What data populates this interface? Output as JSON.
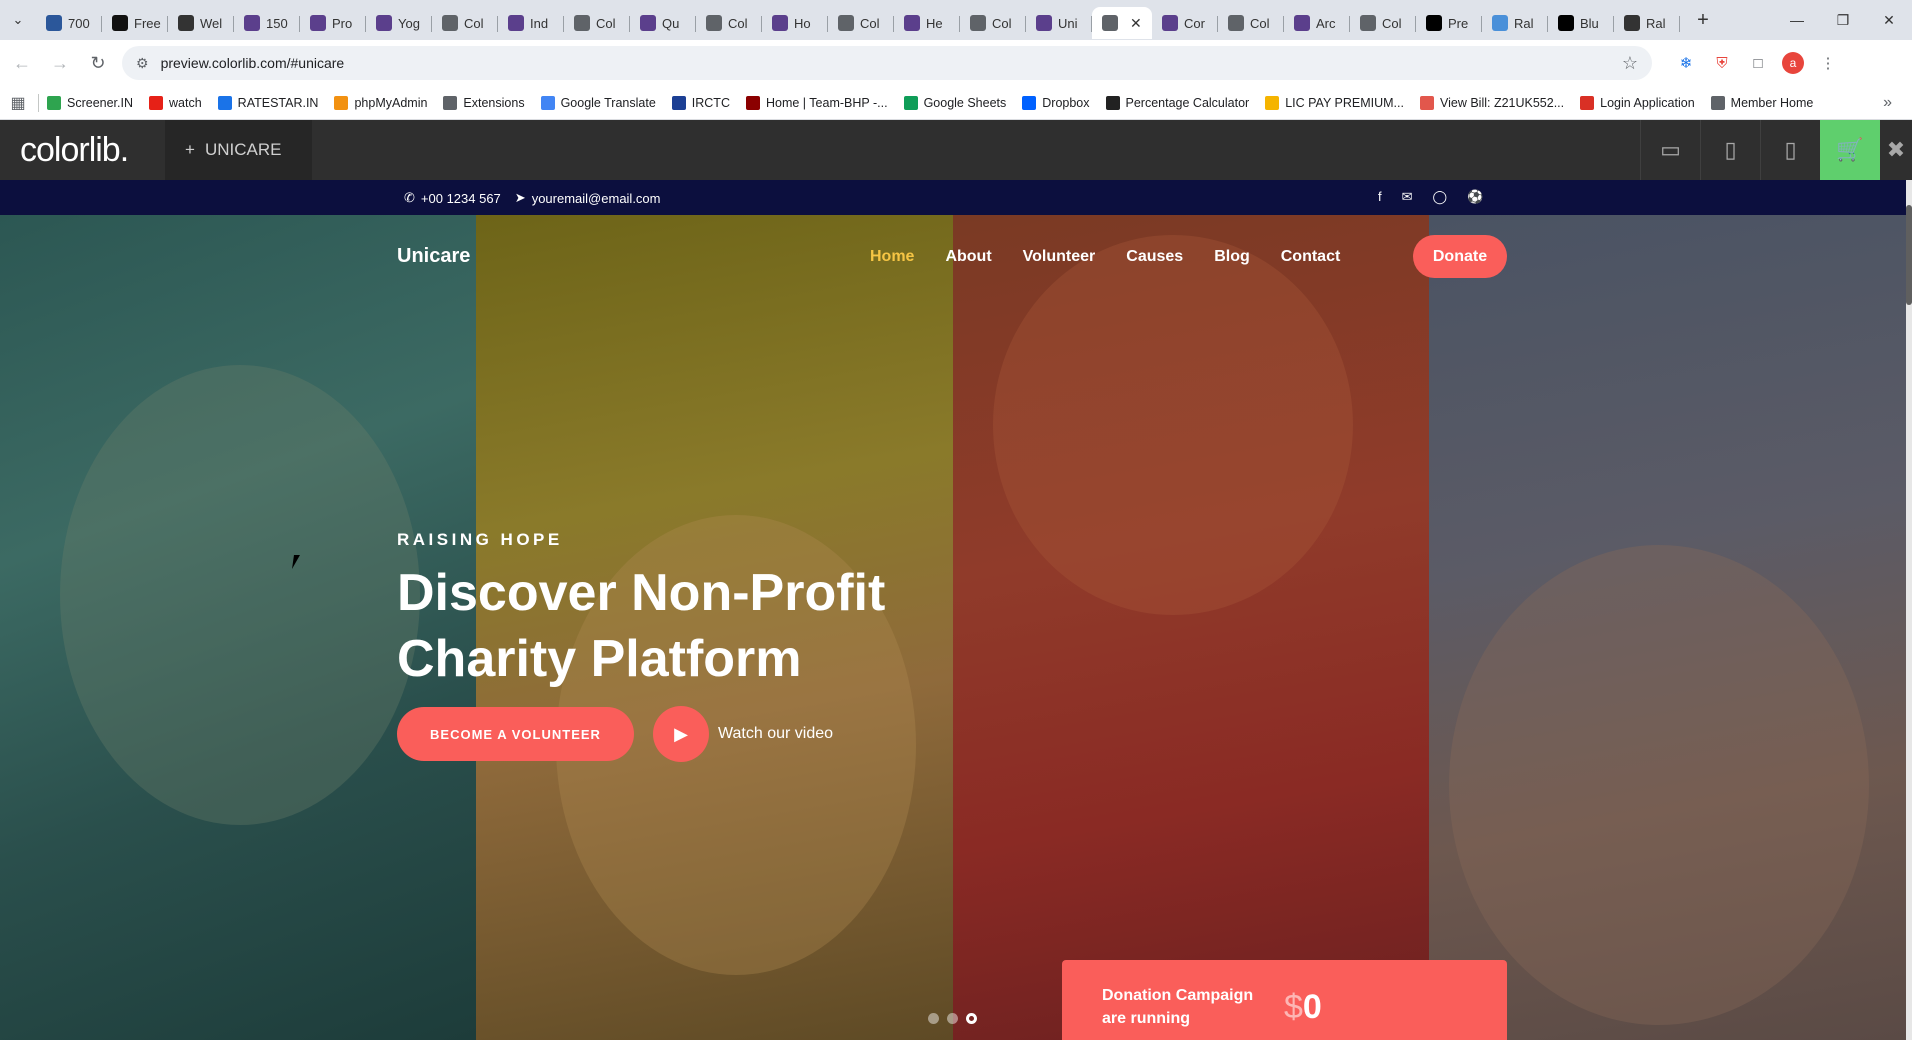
{
  "browser": {
    "tabs": [
      {
        "title": "700",
        "favicon": "word-icon",
        "color": "#2b579a"
      },
      {
        "title": "Free",
        "favicon": "framer-icon",
        "color": "#111111"
      },
      {
        "title": "Wel",
        "favicon": "wix-icon",
        "color": "#333333"
      },
      {
        "title": "150",
        "favicon": "colorlib-icon",
        "color": "#5b3f8c"
      },
      {
        "title": "Pro",
        "favicon": "colorlib-icon",
        "color": "#5b3f8c"
      },
      {
        "title": "Yog",
        "favicon": "colorlib-icon",
        "color": "#5b3f8c"
      },
      {
        "title": "Col",
        "favicon": "globe-icon",
        "color": "#5f6368"
      },
      {
        "title": "Ind",
        "favicon": "colorlib-icon",
        "color": "#5b3f8c"
      },
      {
        "title": "Col",
        "favicon": "globe-icon",
        "color": "#5f6368"
      },
      {
        "title": "Qu",
        "favicon": "colorlib-icon",
        "color": "#5b3f8c"
      },
      {
        "title": "Col",
        "favicon": "globe-icon",
        "color": "#5f6368"
      },
      {
        "title": "Ho",
        "favicon": "colorlib-icon",
        "color": "#5b3f8c"
      },
      {
        "title": "Col",
        "favicon": "globe-icon",
        "color": "#5f6368"
      },
      {
        "title": "He",
        "favicon": "colorlib-icon",
        "color": "#5b3f8c"
      },
      {
        "title": "Col",
        "favicon": "globe-icon",
        "color": "#5f6368"
      },
      {
        "title": "Uni",
        "favicon": "colorlib-icon",
        "color": "#5b3f8c"
      },
      {
        "title": "",
        "favicon": "globe-icon",
        "color": "#5f6368",
        "active": true
      },
      {
        "title": "Cor",
        "favicon": "colorlib-icon",
        "color": "#5b3f8c"
      },
      {
        "title": "Col",
        "favicon": "globe-icon",
        "color": "#5f6368"
      },
      {
        "title": "Arc",
        "favicon": "colorlib-icon",
        "color": "#5b3f8c"
      },
      {
        "title": "Col",
        "favicon": "globe-icon",
        "color": "#5f6368"
      },
      {
        "title": "Pre",
        "favicon": "wikipedia-icon",
        "color": "#000000"
      },
      {
        "title": "Ral",
        "favicon": "web-icon",
        "color": "#4a90d9"
      },
      {
        "title": "Blu",
        "favicon": "wikipedia-icon",
        "color": "#000000"
      },
      {
        "title": "Ral",
        "favicon": "openai-icon",
        "color": "#333333"
      }
    ],
    "url": "preview.colorlib.com/#unicare",
    "bookmarks": [
      {
        "label": "Screener.IN",
        "icon": "chart-icon",
        "color": "#2ea44f"
      },
      {
        "label": "watch",
        "icon": "youtube-icon",
        "color": "#e62117"
      },
      {
        "label": "RATESTAR.IN",
        "icon": "star-icon",
        "color": "#1a73e8"
      },
      {
        "label": "phpMyAdmin",
        "icon": "phpmyadmin-icon",
        "color": "#f29111"
      },
      {
        "label": "Extensions",
        "icon": "puzzle-icon",
        "color": "#5f6368"
      },
      {
        "label": "Google Translate",
        "icon": "translate-icon",
        "color": "#4285f4"
      },
      {
        "label": "IRCTC",
        "icon": "irctc-icon",
        "color": "#1c3f94"
      },
      {
        "label": "Home | Team-BHP -...",
        "icon": "teambhp-icon",
        "color": "#8b0000"
      },
      {
        "label": "Google Sheets",
        "icon": "sheets-icon",
        "color": "#0f9d58"
      },
      {
        "label": "Dropbox",
        "icon": "dropbox-icon",
        "color": "#0061ff"
      },
      {
        "label": "Percentage Calculator",
        "icon": "percent-icon",
        "color": "#222222"
      },
      {
        "label": "LIC PAY PREMIUM...",
        "icon": "lic-icon",
        "color": "#f5b400"
      },
      {
        "label": "View Bill: Z21UK552...",
        "icon": "bill-icon",
        "color": "#e2574c"
      },
      {
        "label": "Login Application",
        "icon": "login-icon",
        "color": "#d93025"
      },
      {
        "label": "Member Home",
        "icon": "globe-icon",
        "color": "#5f6368"
      }
    ]
  },
  "colorlib": {
    "logo": "colorlib.",
    "theme": "UNICARE"
  },
  "site": {
    "phone": "+00 1234 567",
    "email": "youremail@email.com",
    "brand": "Unicare",
    "menu": [
      "Home",
      "About",
      "Volunteer",
      "Causes",
      "Blog",
      "Contact"
    ],
    "donate": "Donate",
    "kicker": "RAISING HOPE",
    "headline_line1": "Discover Non-Profit",
    "headline_line2": "Charity Platform",
    "volunteer_button": "BECOME A VOLUNTEER",
    "watch_video": "Watch our video",
    "campaign_text": "Donation Campaign are running",
    "campaign_currency": "$",
    "campaign_amount": "0",
    "accent_color": "#fa5e5a",
    "active_menu_color": "#f6c544"
  }
}
